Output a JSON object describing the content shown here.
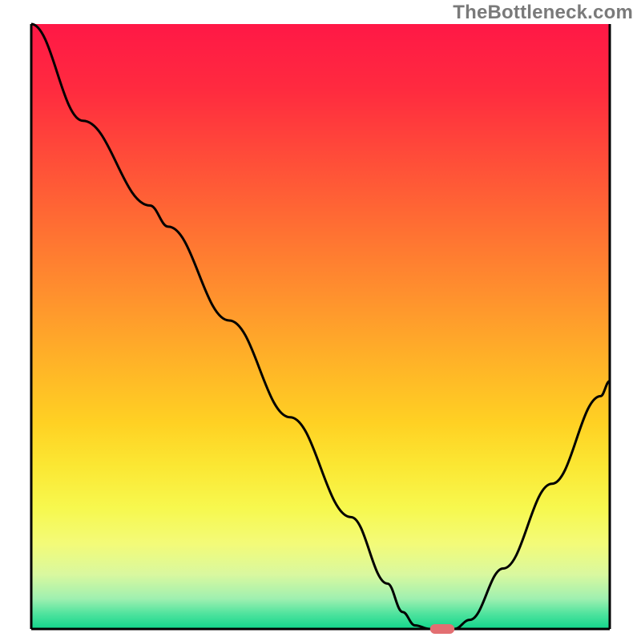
{
  "watermark": "TheBottleneck.com",
  "chart_data": {
    "type": "line",
    "title": "",
    "xlabel": "",
    "ylabel": "",
    "xlim": [
      0,
      100
    ],
    "ylim": [
      0,
      100
    ],
    "grid": false,
    "background_gradient": {
      "stops": [
        {
          "offset": 0.0,
          "color": "#ff1846"
        },
        {
          "offset": 0.11,
          "color": "#ff2b3f"
        },
        {
          "offset": 0.22,
          "color": "#ff4c39"
        },
        {
          "offset": 0.33,
          "color": "#ff6d33"
        },
        {
          "offset": 0.44,
          "color": "#ff8e2e"
        },
        {
          "offset": 0.55,
          "color": "#ffb028"
        },
        {
          "offset": 0.66,
          "color": "#ffd123"
        },
        {
          "offset": 0.73,
          "color": "#fbe733"
        },
        {
          "offset": 0.8,
          "color": "#f7f84e"
        },
        {
          "offset": 0.86,
          "color": "#f3fb79"
        },
        {
          "offset": 0.91,
          "color": "#d9f89f"
        },
        {
          "offset": 0.95,
          "color": "#9ff0b0"
        },
        {
          "offset": 0.975,
          "color": "#4fe39e"
        },
        {
          "offset": 1.0,
          "color": "#11d58b"
        }
      ]
    },
    "series": [
      {
        "name": "bottleneck-curve",
        "color": "#000000",
        "points": [
          {
            "x": 2.5,
            "y": 100.0
          },
          {
            "x": 11.0,
            "y": 84.0
          },
          {
            "x": 22.0,
            "y": 70.0
          },
          {
            "x": 25.0,
            "y": 66.5
          },
          {
            "x": 35.0,
            "y": 51.0
          },
          {
            "x": 45.0,
            "y": 35.0
          },
          {
            "x": 55.0,
            "y": 18.5
          },
          {
            "x": 61.0,
            "y": 7.5
          },
          {
            "x": 63.5,
            "y": 2.8
          },
          {
            "x": 65.5,
            "y": 0.6
          },
          {
            "x": 68.0,
            "y": 0.0
          },
          {
            "x": 72.0,
            "y": 0.0
          },
          {
            "x": 74.5,
            "y": 1.5
          },
          {
            "x": 80.0,
            "y": 10.0
          },
          {
            "x": 88.0,
            "y": 24.0
          },
          {
            "x": 96.0,
            "y": 38.5
          },
          {
            "x": 97.5,
            "y": 41.0
          }
        ]
      }
    ],
    "marker": {
      "name": "optimal-point",
      "x": 70.0,
      "y": 0.0,
      "width": 4.0,
      "height": 1.6,
      "color": "#e36f72"
    },
    "axes": {
      "color": "#000000",
      "left": {
        "x1": 2.5,
        "y1": 0,
        "x2": 2.5,
        "y2": 100
      },
      "bottom": {
        "x1": 2.5,
        "y1": 0,
        "x2": 97.5,
        "y2": 0
      },
      "right": {
        "x1": 97.5,
        "y1": 0,
        "x2": 97.5,
        "y2": 100
      }
    }
  }
}
